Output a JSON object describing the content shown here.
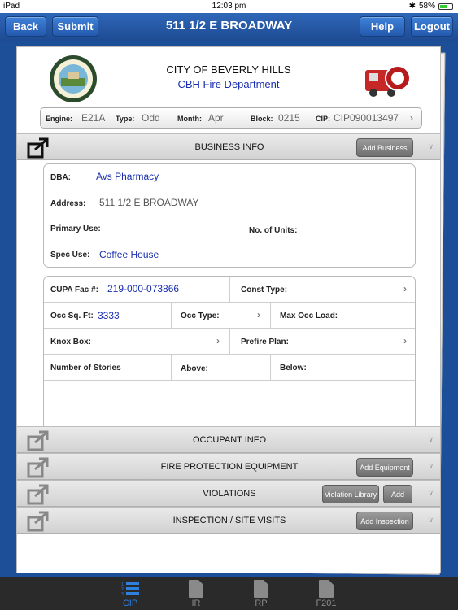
{
  "status": {
    "device": "iPad",
    "time": "12:03 pm",
    "battery": "58%"
  },
  "nav": {
    "back": "Back",
    "submit": "Submit",
    "title": "511  1/2 E BROADWAY",
    "help": "Help",
    "logout": "Logout"
  },
  "header": {
    "city": "CITY OF BEVERLY HILLS",
    "dept": "CBH Fire Department"
  },
  "infobar": {
    "engine_label": "Engine:",
    "engine": "E21A",
    "type_label": "Type:",
    "type": "Odd",
    "month_label": "Month:",
    "month": "Apr",
    "block_label": "Block:",
    "block": "0215",
    "cip_label": "CIP:",
    "cip": "CIP090013497"
  },
  "sections": {
    "business": {
      "title": "BUSINESS INFO",
      "button": "Add Business"
    },
    "occupant": {
      "title": "OCCUPANT INFO"
    },
    "fire": {
      "title": "FIRE PROTECTION EQUIPMENT",
      "button": "Add Equipment"
    },
    "violations": {
      "title": "VIOLATIONS",
      "button1": "Violation Library",
      "button2": "Add"
    },
    "inspection": {
      "title": "INSPECTION / SITE VISITS",
      "button": "Add Inspection"
    }
  },
  "business": {
    "dba_label": "DBA:",
    "dba": "Avs Pharmacy",
    "address_label": "Address:",
    "address": "511  1/2 E BROADWAY",
    "primary_label": "Primary Use:",
    "units_label": "No. of Units:",
    "spec_label": "Spec Use:",
    "spec": "Coffee House"
  },
  "facility": {
    "cupa_label": "CUPA Fac #:",
    "cupa": "219-000-073866",
    "const_label": "Const Type:",
    "occsq_label": "Occ Sq. Ft:",
    "occsq": "3333",
    "occtype_label": "Occ Type:",
    "maxocc_label": "Max Occ Load:",
    "knox_label": "Knox Box:",
    "prefire_label": "Prefire Plan:",
    "stories_label": "Number of Stories",
    "above_label": "Above:",
    "below_label": "Below:"
  },
  "tabs": [
    {
      "label": "CIP"
    },
    {
      "label": "IR"
    },
    {
      "label": "RP"
    },
    {
      "label": "F201"
    }
  ],
  "colors": {
    "nav": "#1e4b93",
    "accent": "#1a2fb0",
    "active_tab": "#2d7fe0"
  }
}
